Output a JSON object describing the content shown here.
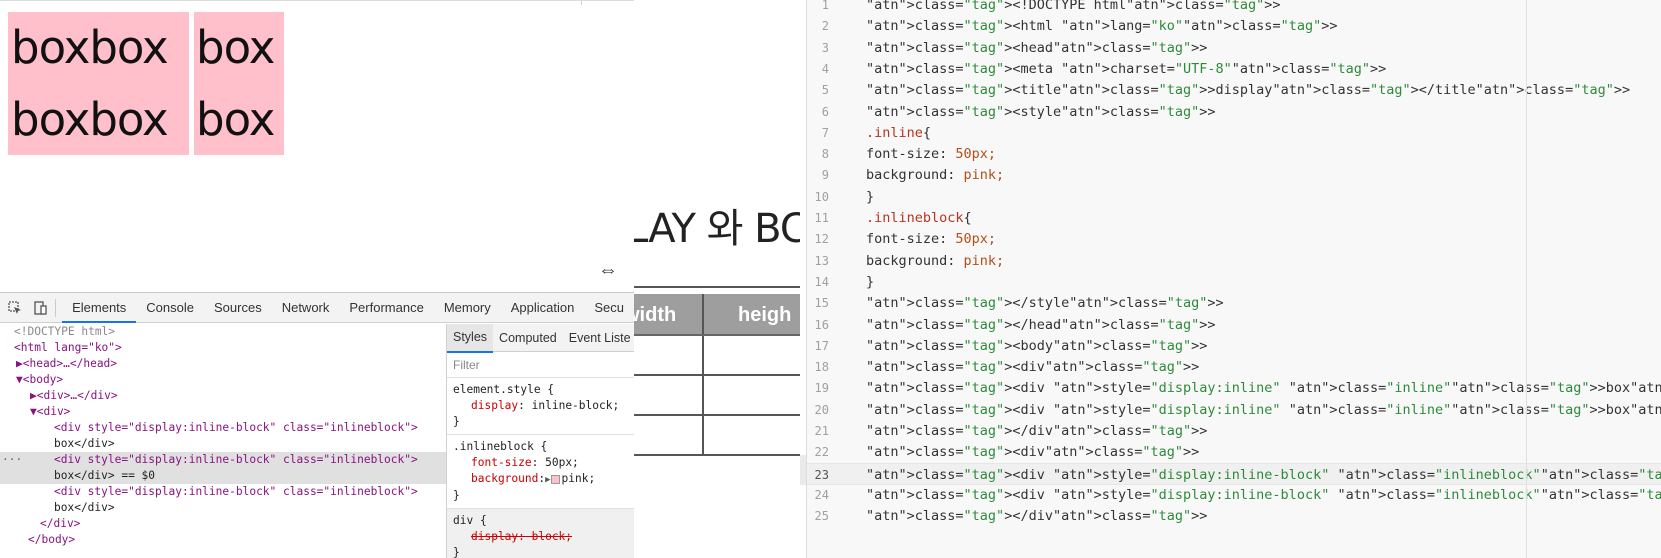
{
  "viewport": {
    "boxes": [
      "boxbox",
      "box",
      "boxbox",
      "box"
    ],
    "resize_icon": "⇔"
  },
  "slide": {
    "title": "LAY 와 BC",
    "col1": "width",
    "col2": "heigh",
    "arrow": "›"
  },
  "devtools": {
    "tabs": [
      "Elements",
      "Console",
      "Sources",
      "Network",
      "Performance",
      "Memory",
      "Application",
      "Secu"
    ],
    "active_tab": "Elements",
    "dom": [
      {
        "indent": 0,
        "text": "<!DOCTYPE html>"
      },
      {
        "indent": 0,
        "text": "<html lang=\"ko\">"
      },
      {
        "indent": 1,
        "text": "▶<head>…</head>"
      },
      {
        "indent": 1,
        "text": "▼<body>"
      },
      {
        "indent": 2,
        "text": "▶<div>…</div>"
      },
      {
        "indent": 2,
        "text": "▼<div>"
      },
      {
        "indent": 3,
        "text": "<div style=\"display:inline-block\" class=\"inlineblock\">"
      },
      {
        "indent": 3,
        "text": "box</div>"
      },
      {
        "indent": 3,
        "text": "<div style=\"display:inline-block\" class=\"inlineblock\">"
      },
      {
        "indent": 3,
        "text": "box</div> == $0"
      },
      {
        "indent": 3,
        "text": "<div style=\"display:inline-block\" class=\"inlineblock\">"
      },
      {
        "indent": 3,
        "text": "box</div>"
      },
      {
        "indent": 2,
        "text": "</div>"
      },
      {
        "indent": 1,
        "text": "</body>"
      }
    ],
    "styles_tabs": [
      "Styles",
      "Computed",
      "Event Liste"
    ],
    "filter_placeholder": "Filter",
    "rules": {
      "element_style": "element.style {",
      "element_prop": "display",
      "element_val": "inline-block;",
      "close": "}",
      "inlineblock_sel": ".inlineblock {",
      "font_prop": "font-size",
      "font_val": "50px;",
      "bg_prop": "background",
      "bg_val": "pink;",
      "div_sel": "div {",
      "div_prop": "display: block;"
    }
  },
  "editor": {
    "lines": [
      "<!DOCTYPE html>",
      "<html lang=\"ko\">",
      "<head>",
      "<meta charset=\"UTF-8\">",
      "<title>display</title>",
      "<style>",
      "    .inline{",
      "        font-size: 50px;",
      "        background: pink;",
      "    }",
      "    .inlineblock{",
      "        font-size: 50px;",
      "        background: pink;",
      "    }",
      "</style>",
      "</head>",
      "<body>",
      "    <div>",
      "        <div style=\"display:inline\" class=\"inline\">box</div><div style=\"display:inline\" class=\"i",
      "        <div style=\"display:inline\" class=\"inline\">box</div>",
      "    </div>",
      "    <div>",
      "        <div style=\"display:inline-block\" class=\"inlineblock\">box</div><div style=\"display:inlin",
      "        <div style=\"display:inline-block\" class=\"inlineblock\">box</div>",
      "    </div>"
    ],
    "current_line": 23
  }
}
